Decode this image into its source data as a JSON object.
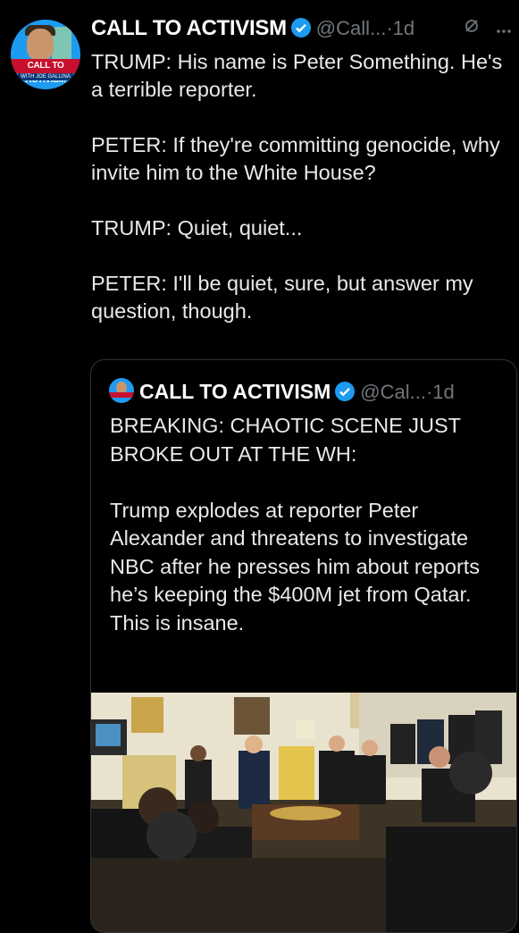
{
  "tweet": {
    "author_name": "CALL TO ACTIVISM",
    "handle": "@Call...",
    "time": "·1d",
    "avatar_banner": "CALL TO ACTIVISM",
    "avatar_sub": "WITH JOE GALLINA",
    "text": "TRUMP: His name is Peter Something. He's a terrible reporter.\n\nPETER: If they're committing genocide, why invite him to the White House?\n\nTRUMP: Quiet, quiet...\n\nPETER: I'll be quiet, sure, but answer my question, though."
  },
  "quoted": {
    "author_name": "CALL TO ACTIVISM",
    "handle": "@Cal...",
    "time": "·1d",
    "text": "BREAKING: CHAOTIC SCENE JUST BROKE OUT AT THE WH:\n\nTrump explodes at reporter Peter Alexander and threatens to investigate NBC after he presses him about reports he’s keeping the $400M jet from Qatar. This is insane."
  },
  "icons": {
    "verified": "verified-badge-icon",
    "grok": "grok-icon",
    "more": "more-options-icon"
  },
  "colors": {
    "background": "#000000",
    "text": "#e7e9ea",
    "secondary": "#71767b",
    "verified": "#1d9bf0",
    "border": "#2f3336"
  }
}
